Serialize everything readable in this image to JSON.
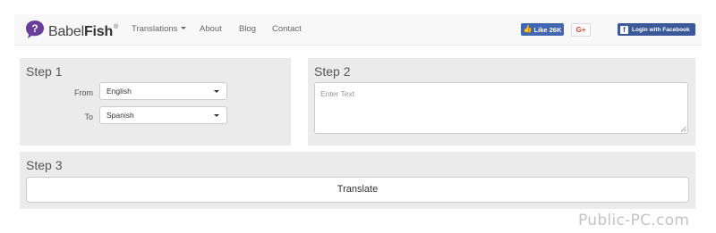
{
  "nav": {
    "brand_regular": "Babel",
    "brand_bold": "Fish",
    "brand_mark": "®",
    "items": [
      {
        "label": "Translations",
        "has_dropdown": true
      },
      {
        "label": "About"
      },
      {
        "label": "Blog"
      },
      {
        "label": "Contact"
      }
    ],
    "like_label": "Like 26K",
    "gplus_label": "G+",
    "login_label": "Login with Facebook"
  },
  "step1": {
    "title": "Step 1",
    "from_label": "From",
    "from_value": "English",
    "to_label": "To",
    "to_value": "Spanish"
  },
  "step2": {
    "title": "Step 2",
    "placeholder": "Enter Text"
  },
  "step3": {
    "title": "Step 3",
    "button_label": "Translate"
  },
  "watermark": "Public-PC.com",
  "colors": {
    "brand_purple": "#6a3d9a",
    "facebook_like": "#4267b2",
    "facebook_login": "#3b5998",
    "gplus_red": "#dd4b39",
    "panel_bg": "#ebebeb",
    "navbar_bg": "#f8f8f8"
  }
}
